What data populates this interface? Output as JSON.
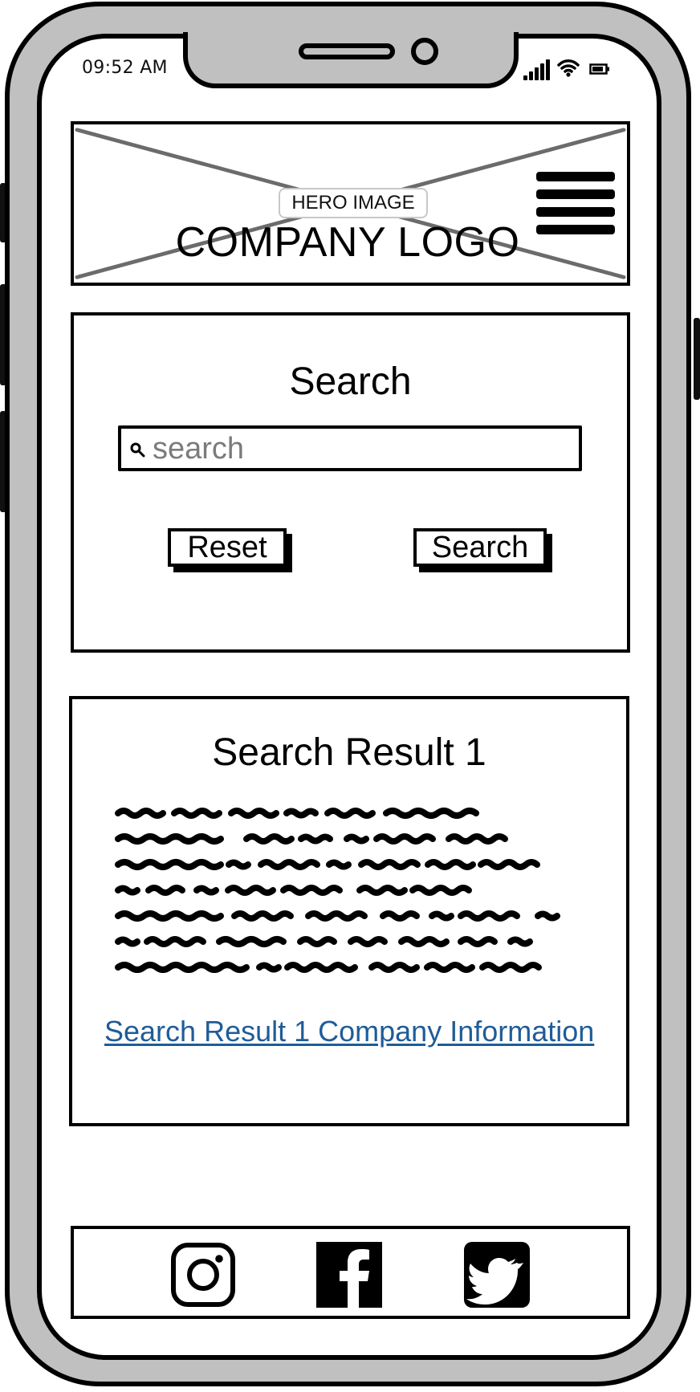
{
  "status_bar": {
    "time": "09:52 AM",
    "icons": [
      "cellular-signal-icon",
      "wifi-icon",
      "battery-icon"
    ]
  },
  "header": {
    "hero_image_label": "HERO IMAGE",
    "company_logo": "COMPANY LOGO",
    "menu_icon": "hamburger-menu-icon"
  },
  "search": {
    "title": "Search",
    "placeholder": "search",
    "value": "",
    "reset_label": "Reset",
    "search_label": "Search",
    "icon": "search-icon"
  },
  "result": {
    "title": "Search Result 1",
    "link_text": "Search Result 1 Company Information",
    "placeholder_text_lines": 7
  },
  "footer": {
    "social_icons": [
      "instagram-icon",
      "facebook-icon",
      "twitter-icon"
    ]
  },
  "colors": {
    "device_gray": "#c0c0c0",
    "stroke": "#000000",
    "link_blue": "#1f5c98",
    "placeholder_gray": "#7b7b7b",
    "hero_cross_gray": "#6b6b6b"
  }
}
